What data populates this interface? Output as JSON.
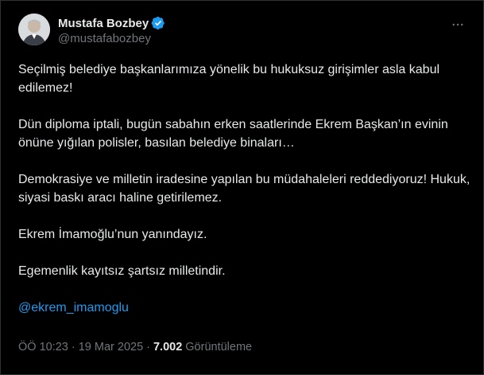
{
  "author": {
    "display_name": "Mustafa Bozbey",
    "handle": "@mustafabozbey",
    "verified": true,
    "avatar_icon": "profile-photo",
    "verified_icon": "verified-badge-icon",
    "more_icon": "more-horizontal-icon"
  },
  "tweet": {
    "paragraphs": [
      "Seçilmiş belediye başkanlarımıza yönelik bu hukuksuz girişimler asla kabul edilemez!",
      "Dün diploma iptali, bugün sabahın erken saatlerinde Ekrem Başkan’ın evinin önüne yığılan polisler, basılan belediye binaları…",
      "Demokrasiye ve milletin iradesine yapılan bu müdahaleleri reddediyoruz! Hukuk, siyasi baskı aracı haline getirilemez.",
      "Ekrem İmamoğlu’nun yanındayız.",
      "Egemenlik kayıtsız şartsız milletindir."
    ],
    "mention": "@ekrem_imamoglu"
  },
  "meta": {
    "time": "ÖÖ 10:23",
    "separator": "·",
    "date": "19 Mar 2025",
    "views_count": "7.002",
    "views_label": "Görüntüleme"
  },
  "colors": {
    "background": "#000000",
    "text": "#e7e9ea",
    "secondary": "#71767b",
    "accent": "#1d9bf0"
  }
}
